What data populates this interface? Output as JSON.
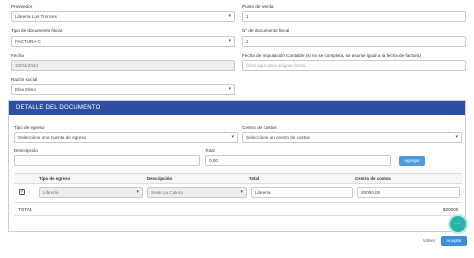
{
  "form": {
    "proveedor": {
      "label": "Proveedor",
      "value": "Librería Los Tronces"
    },
    "punto_venta": {
      "label": "Punto de Venta",
      "value": "1"
    },
    "tipo_doc": {
      "label": "Tipo de documento fiscal",
      "value": "FACTURA C"
    },
    "nro_doc": {
      "label": "N° de documento fiscal",
      "value": "1"
    },
    "fecha": {
      "label": "Fecha",
      "value": "10/04/2024"
    },
    "fecha_imputacion": {
      "label": "Fecha de Imputación Contable (si no se completa, se asume igual a la fecha de factura)",
      "placeholder": "Click aquí para asignar fecha"
    },
    "razon_social": {
      "label": "Razón social",
      "value": "Elsa Dimo"
    }
  },
  "detalle": {
    "title": "DETALLE DEL DOCUMENTO",
    "tipo_egreso": {
      "label": "Tipo de egreso",
      "value": "Seleccione una cuenta de egreso"
    },
    "centro_costos": {
      "label": "Centro de costos",
      "value": "Seleccione un centro de costos"
    },
    "descripcion": {
      "label": "Descripción",
      "value": ""
    },
    "total": {
      "label": "Total",
      "value": "0,00"
    },
    "agregar_label": "Agregar",
    "table": {
      "headers": [
        "Tipo de egreso",
        "Descripción",
        "Total",
        "Centro de costos"
      ],
      "rows": [
        {
          "checked": true,
          "tipo": "Librería",
          "descripcion": "Sede La Calera",
          "total": "Librería",
          "centro": "20000,00"
        }
      ]
    },
    "total_label": "TOTAL",
    "total_value": "$20000"
  },
  "actions": {
    "volver": "Volver",
    "aceptar": "Aceptar"
  },
  "colors": {
    "header_bg": "#2e4fa1",
    "accent": "#4a9be0",
    "chat": "#2bb5a8"
  },
  "icons": {
    "chat": "chat-dots-icon",
    "select": "chevron-down-icon",
    "check": "checkmark-icon"
  }
}
